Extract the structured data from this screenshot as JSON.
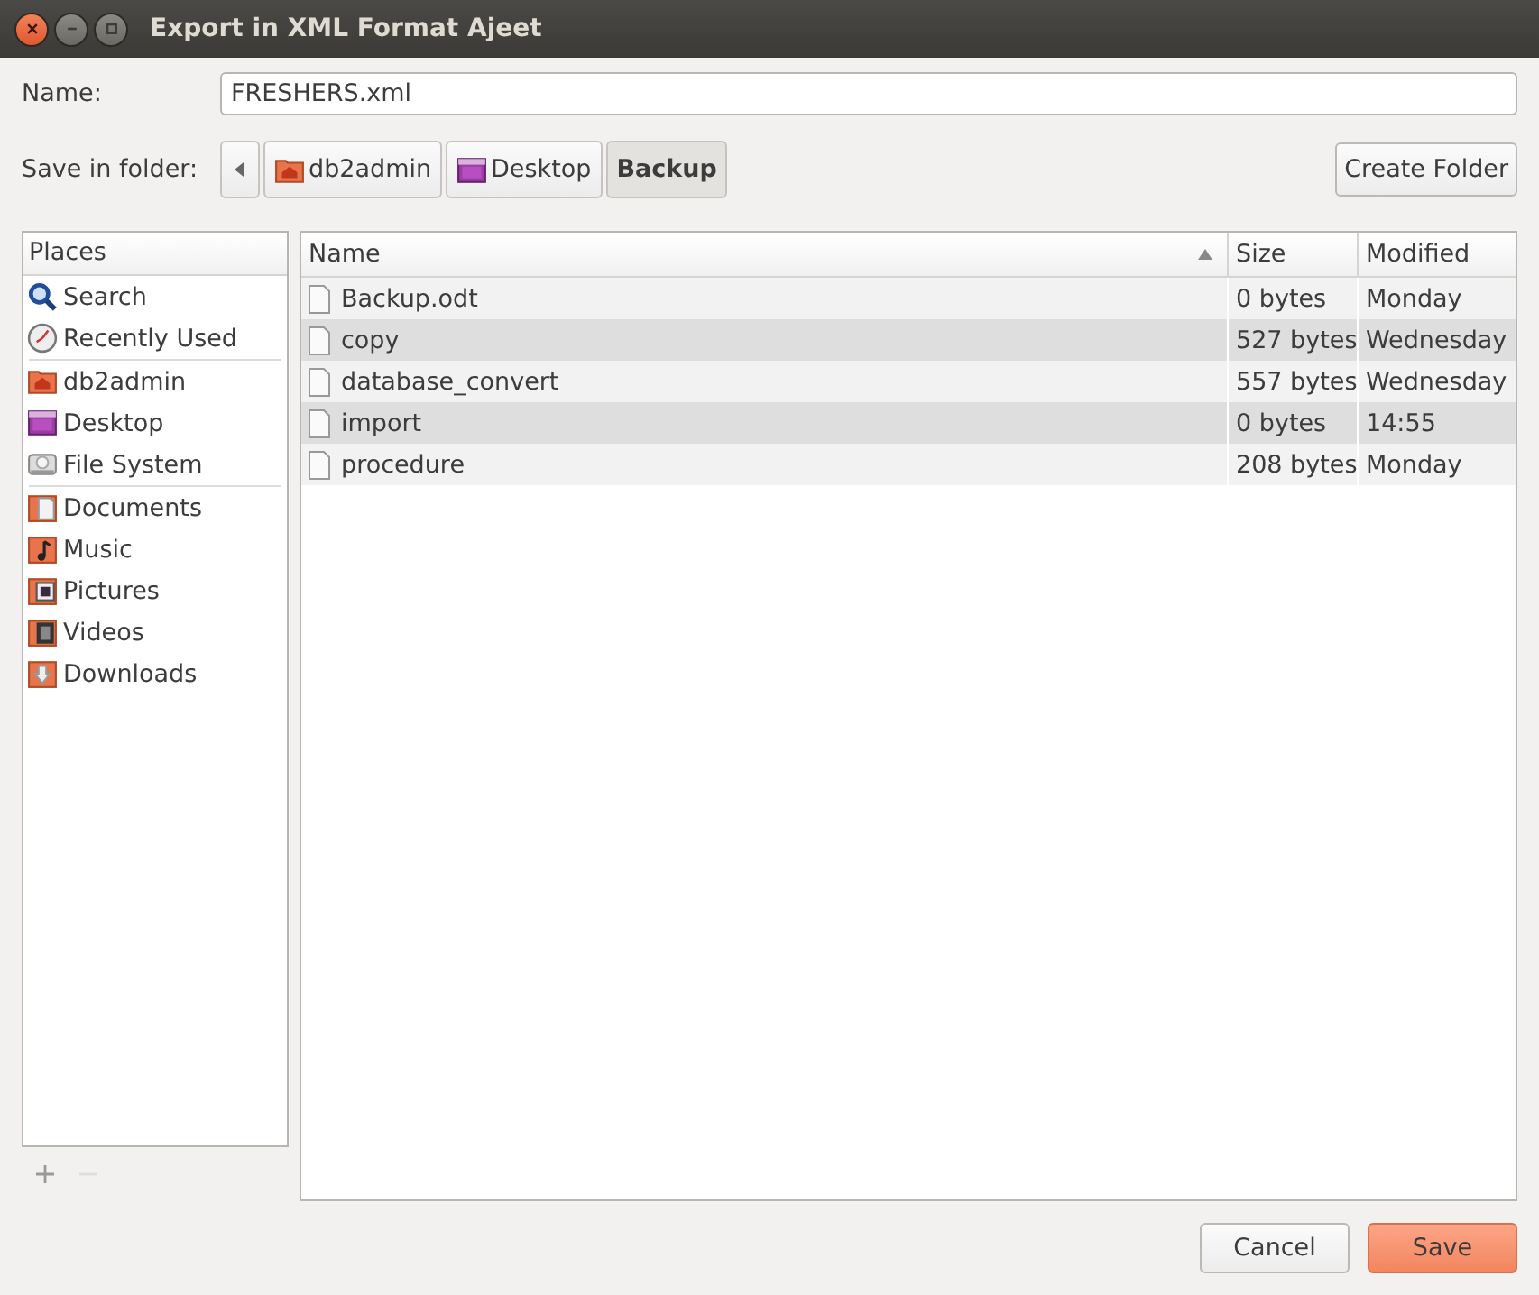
{
  "window": {
    "title": "Export in XML Format Ajeet"
  },
  "name_field": {
    "label": "Name:",
    "value": "FRESHERS.xml"
  },
  "folder_bar": {
    "label": "Save in folder:",
    "path": [
      {
        "label": "db2admin",
        "kind": "home",
        "selected": false
      },
      {
        "label": "Desktop",
        "kind": "desktop",
        "selected": false
      },
      {
        "label": "Backup",
        "kind": "none",
        "selected": true
      }
    ],
    "create_button": "Create Folder"
  },
  "places": {
    "heading": "Places",
    "groups": [
      [
        {
          "label": "Search",
          "kind": "search"
        },
        {
          "label": "Recently Used",
          "kind": "recent"
        }
      ],
      [
        {
          "label": "db2admin",
          "kind": "home"
        },
        {
          "label": "Desktop",
          "kind": "desktop"
        },
        {
          "label": "File System",
          "kind": "drive"
        }
      ],
      [
        {
          "label": "Documents",
          "kind": "documents"
        },
        {
          "label": "Music",
          "kind": "music"
        },
        {
          "label": "Pictures",
          "kind": "pictures"
        },
        {
          "label": "Videos",
          "kind": "videos"
        },
        {
          "label": "Downloads",
          "kind": "downloads"
        }
      ]
    ],
    "add_disabled": false,
    "remove_disabled": true
  },
  "files": {
    "columns": [
      {
        "label": "Name",
        "sorted": true
      },
      {
        "label": "Size",
        "sorted": false
      },
      {
        "label": "Modified",
        "sorted": false
      }
    ],
    "rows": [
      {
        "name": "Backup.odt",
        "size": "0 bytes",
        "modified": "Monday"
      },
      {
        "name": "copy",
        "size": "527 bytes",
        "modified": "Wednesday"
      },
      {
        "name": "database_convert",
        "size": "557 bytes",
        "modified": "Wednesday"
      },
      {
        "name": "import",
        "size": "0 bytes",
        "modified": "14:55"
      },
      {
        "name": "procedure",
        "size": "208 bytes",
        "modified": "Monday"
      }
    ]
  },
  "buttons": [
    {
      "label": "Cancel",
      "kind": "secondary"
    },
    {
      "label": "Save",
      "kind": "primary"
    }
  ]
}
